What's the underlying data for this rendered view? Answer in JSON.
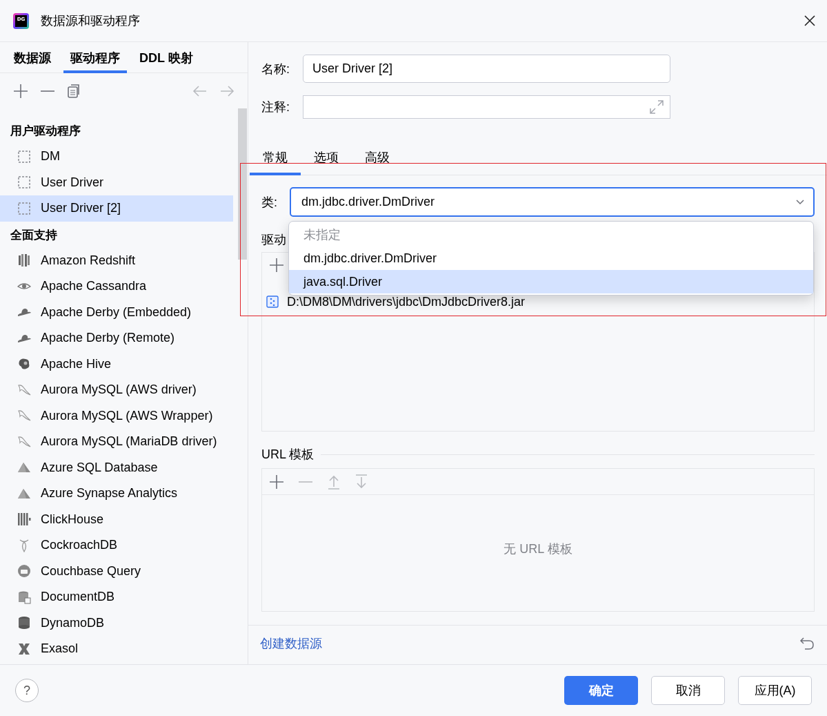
{
  "window": {
    "logo_text": "DG",
    "title": "数据源和驱动程序"
  },
  "tabs": [
    {
      "label": "数据源",
      "selected": false
    },
    {
      "label": "驱动程序",
      "selected": true
    },
    {
      "label": "DDL 映射",
      "selected": false
    }
  ],
  "sidebar": {
    "groups": [
      {
        "title": "用户驱动程序",
        "items": [
          {
            "label": "DM",
            "selected": false
          },
          {
            "label": "User Driver",
            "selected": false
          },
          {
            "label": "User Driver [2]",
            "selected": true
          }
        ]
      },
      {
        "title": "全面支持",
        "items": [
          {
            "label": "Amazon Redshift",
            "selected": false
          },
          {
            "label": "Apache Cassandra",
            "selected": false
          },
          {
            "label": "Apache Derby (Embedded)",
            "selected": false
          },
          {
            "label": "Apache Derby (Remote)",
            "selected": false
          },
          {
            "label": "Apache Hive",
            "selected": false
          },
          {
            "label": "Aurora MySQL (AWS driver)",
            "selected": false
          },
          {
            "label": "Aurora MySQL (AWS Wrapper)",
            "selected": false
          },
          {
            "label": "Aurora MySQL (MariaDB driver)",
            "selected": false
          },
          {
            "label": "Azure SQL Database",
            "selected": false
          },
          {
            "label": "Azure Synapse Analytics",
            "selected": false
          },
          {
            "label": "ClickHouse",
            "selected": false
          },
          {
            "label": "CockroachDB",
            "selected": false
          },
          {
            "label": "Couchbase Query",
            "selected": false
          },
          {
            "label": "DocumentDB",
            "selected": false
          },
          {
            "label": "DynamoDB",
            "selected": false
          },
          {
            "label": "Exasol",
            "selected": false
          }
        ]
      }
    ]
  },
  "form": {
    "name_label": "名称:",
    "name_value": "User Driver [2]",
    "comment_label": "注释:",
    "tabs": [
      {
        "label": "常规",
        "selected": true
      },
      {
        "label": "选项",
        "selected": false
      },
      {
        "label": "高级",
        "selected": false
      }
    ],
    "class_label": "类:",
    "class_value": "dm.jdbc.driver.DmDriver",
    "class_expanded": true,
    "class_options": [
      {
        "label": "未指定",
        "kind": "placeholder",
        "selected": false
      },
      {
        "label": "dm.jdbc.driver.DmDriver",
        "kind": "option",
        "selected": false
      },
      {
        "label": "java.sql.Driver",
        "kind": "option",
        "selected": true
      }
    ],
    "files_label": "驱动",
    "files": [
      "D:\\DM8\\DM\\drivers\\jdbc\\DmJdbcDriver8.jar"
    ],
    "url_label": "URL 模板",
    "url_empty": "无 URL 模板",
    "create_link": "创建数据源"
  },
  "footer": {
    "help_label": "?",
    "buttons": [
      {
        "label": "确定",
        "kind": "primary"
      },
      {
        "label": "取消",
        "kind": "secondary"
      },
      {
        "label": "应用(A)",
        "kind": "secondary"
      }
    ]
  }
}
